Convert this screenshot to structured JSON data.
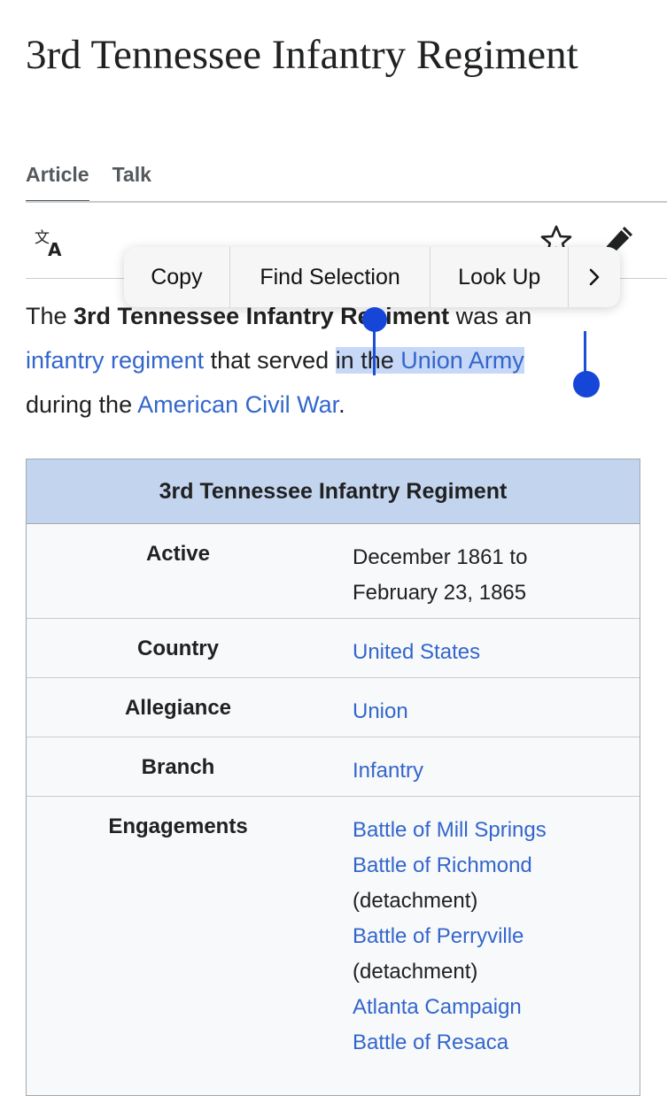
{
  "page": {
    "title": "3rd Tennessee Infantry Regiment",
    "tabs": [
      {
        "label": "Article",
        "active": true
      },
      {
        "label": "Talk",
        "active": false
      }
    ]
  },
  "toolbar": {
    "icons": [
      "translate-icon",
      "star-icon",
      "edit-pencil-icon"
    ]
  },
  "intro": {
    "prefix": "The ",
    "subject": "3rd Tennessee Infantry Regiment",
    "after_subject": " was an ",
    "link_1": "infantry regiment",
    "middle": " that served ",
    "selected_plain": "in the ",
    "link_2": "Union Army",
    "line3_start": "during the ",
    "link_3": "American Civil War",
    "end": "."
  },
  "context_menu": {
    "copy": "Copy",
    "find_selection": "Find Selection",
    "look_up": "Look Up",
    "more": "›"
  },
  "infobox": {
    "title": "3rd Tennessee Infantry Regiment",
    "rows": {
      "active": {
        "label": "Active",
        "value_lines": [
          "December 1861 to",
          "February 23, 1865"
        ]
      },
      "country": {
        "label": "Country",
        "value": "United States"
      },
      "allegiance": {
        "label": "Allegiance",
        "value": "Union"
      },
      "branch": {
        "label": "Branch",
        "value": "Infantry"
      },
      "engagements": {
        "label": "Engagements",
        "items": [
          "Battle of Mill Springs",
          "Battle of Richmond",
          "(detachment)",
          "Battle of Perryville",
          "(detachment)",
          "Atlanta Campaign",
          "Battle of Resaca"
        ]
      }
    }
  },
  "colors": {
    "link": "#3366cc",
    "selection_highlight": "#c6d7f7",
    "selection_handle": "#1546d8",
    "infobox_header": "#c3d4ee"
  }
}
